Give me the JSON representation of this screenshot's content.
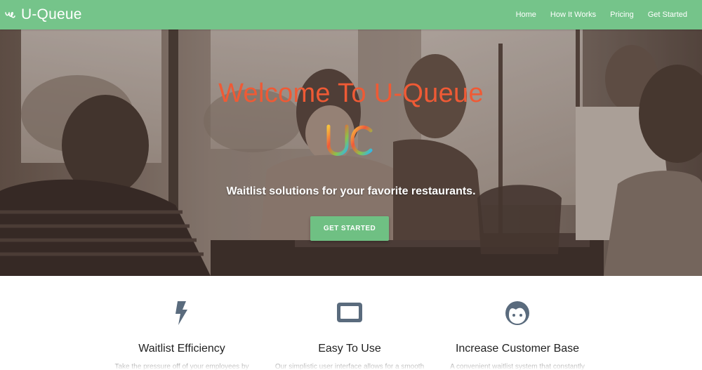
{
  "brand": {
    "name": "U-Queue",
    "logo_icon": "uq-script-icon"
  },
  "nav": {
    "links": [
      {
        "label": "Home"
      },
      {
        "label": "How It Works"
      },
      {
        "label": "Pricing"
      },
      {
        "label": "Get Started"
      }
    ]
  },
  "hero": {
    "title": "Welcome To U-Queue",
    "logo_mark": "uq-gradient-logo",
    "tagline": "Waitlist solutions for your favorite restaurants.",
    "cta_label": "GET STARTED"
  },
  "features": [
    {
      "icon": "lightning-bolt-icon",
      "title": "Waitlist Efficiency",
      "description": "Take the pressure off of your employees by"
    },
    {
      "icon": "tablet-icon",
      "title": "Easy To Use",
      "description": "Our simplistic user interface allows for a smooth"
    },
    {
      "icon": "face-icon",
      "title": "Increase Customer Base",
      "description": "A convenient waitlist system that constantly"
    }
  ],
  "colors": {
    "nav_green": "#75c48a",
    "button_green": "#6fc083",
    "title_orange": "#ef5a35",
    "icon_slate": "#5a6b7d"
  }
}
